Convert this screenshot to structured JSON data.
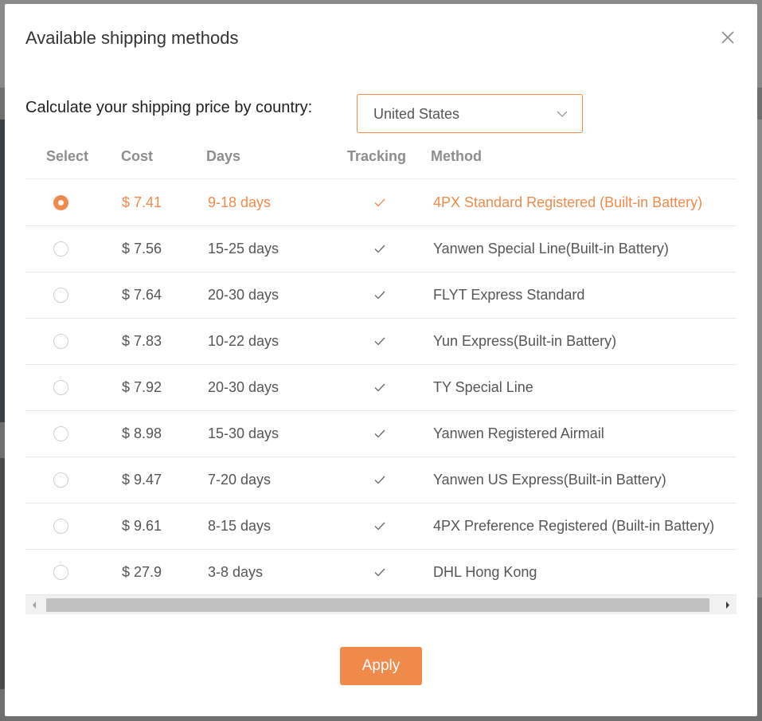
{
  "modal": {
    "title": "Available shipping methods",
    "close_icon": "close-icon"
  },
  "country": {
    "label": "Calculate your shipping price by country:",
    "selected": "United States"
  },
  "table": {
    "headers": {
      "select": "Select",
      "cost": "Cost",
      "days": "Days",
      "tracking": "Tracking",
      "method": "Method"
    },
    "rows": [
      {
        "cost": "$ 7.41",
        "days": "9-18 days",
        "tracking": true,
        "method": "4PX Standard Registered (Built-in Battery)",
        "selected": true
      },
      {
        "cost": "$ 7.56",
        "days": "15-25 days",
        "tracking": true,
        "method": "Yanwen Special Line(Built-in Battery)",
        "selected": false
      },
      {
        "cost": "$ 7.64",
        "days": "20-30 days",
        "tracking": true,
        "method": "FLYT Express Standard",
        "selected": false
      },
      {
        "cost": "$ 7.83",
        "days": "10-22 days",
        "tracking": true,
        "method": "Yun Express(Built-in Battery)",
        "selected": false
      },
      {
        "cost": "$ 7.92",
        "days": "20-30 days",
        "tracking": true,
        "method": "TY Special Line",
        "selected": false
      },
      {
        "cost": "$ 8.98",
        "days": "15-30 days",
        "tracking": true,
        "method": "Yanwen Registered Airmail",
        "selected": false
      },
      {
        "cost": "$ 9.47",
        "days": "7-20 days",
        "tracking": true,
        "method": "Yanwen US Express(Built-in Battery)",
        "selected": false
      },
      {
        "cost": "$ 9.61",
        "days": "8-15 days",
        "tracking": true,
        "method": "4PX Preference Registered (Built-in Battery)",
        "selected": false
      },
      {
        "cost": "$ 27.9",
        "days": "3-8 days",
        "tracking": true,
        "method": "DHL Hong Kong",
        "selected": false
      }
    ]
  },
  "apply_label": "Apply",
  "colors": {
    "accent": "#f08a4b",
    "text": "#555555",
    "header_text": "#8d8d8d"
  }
}
